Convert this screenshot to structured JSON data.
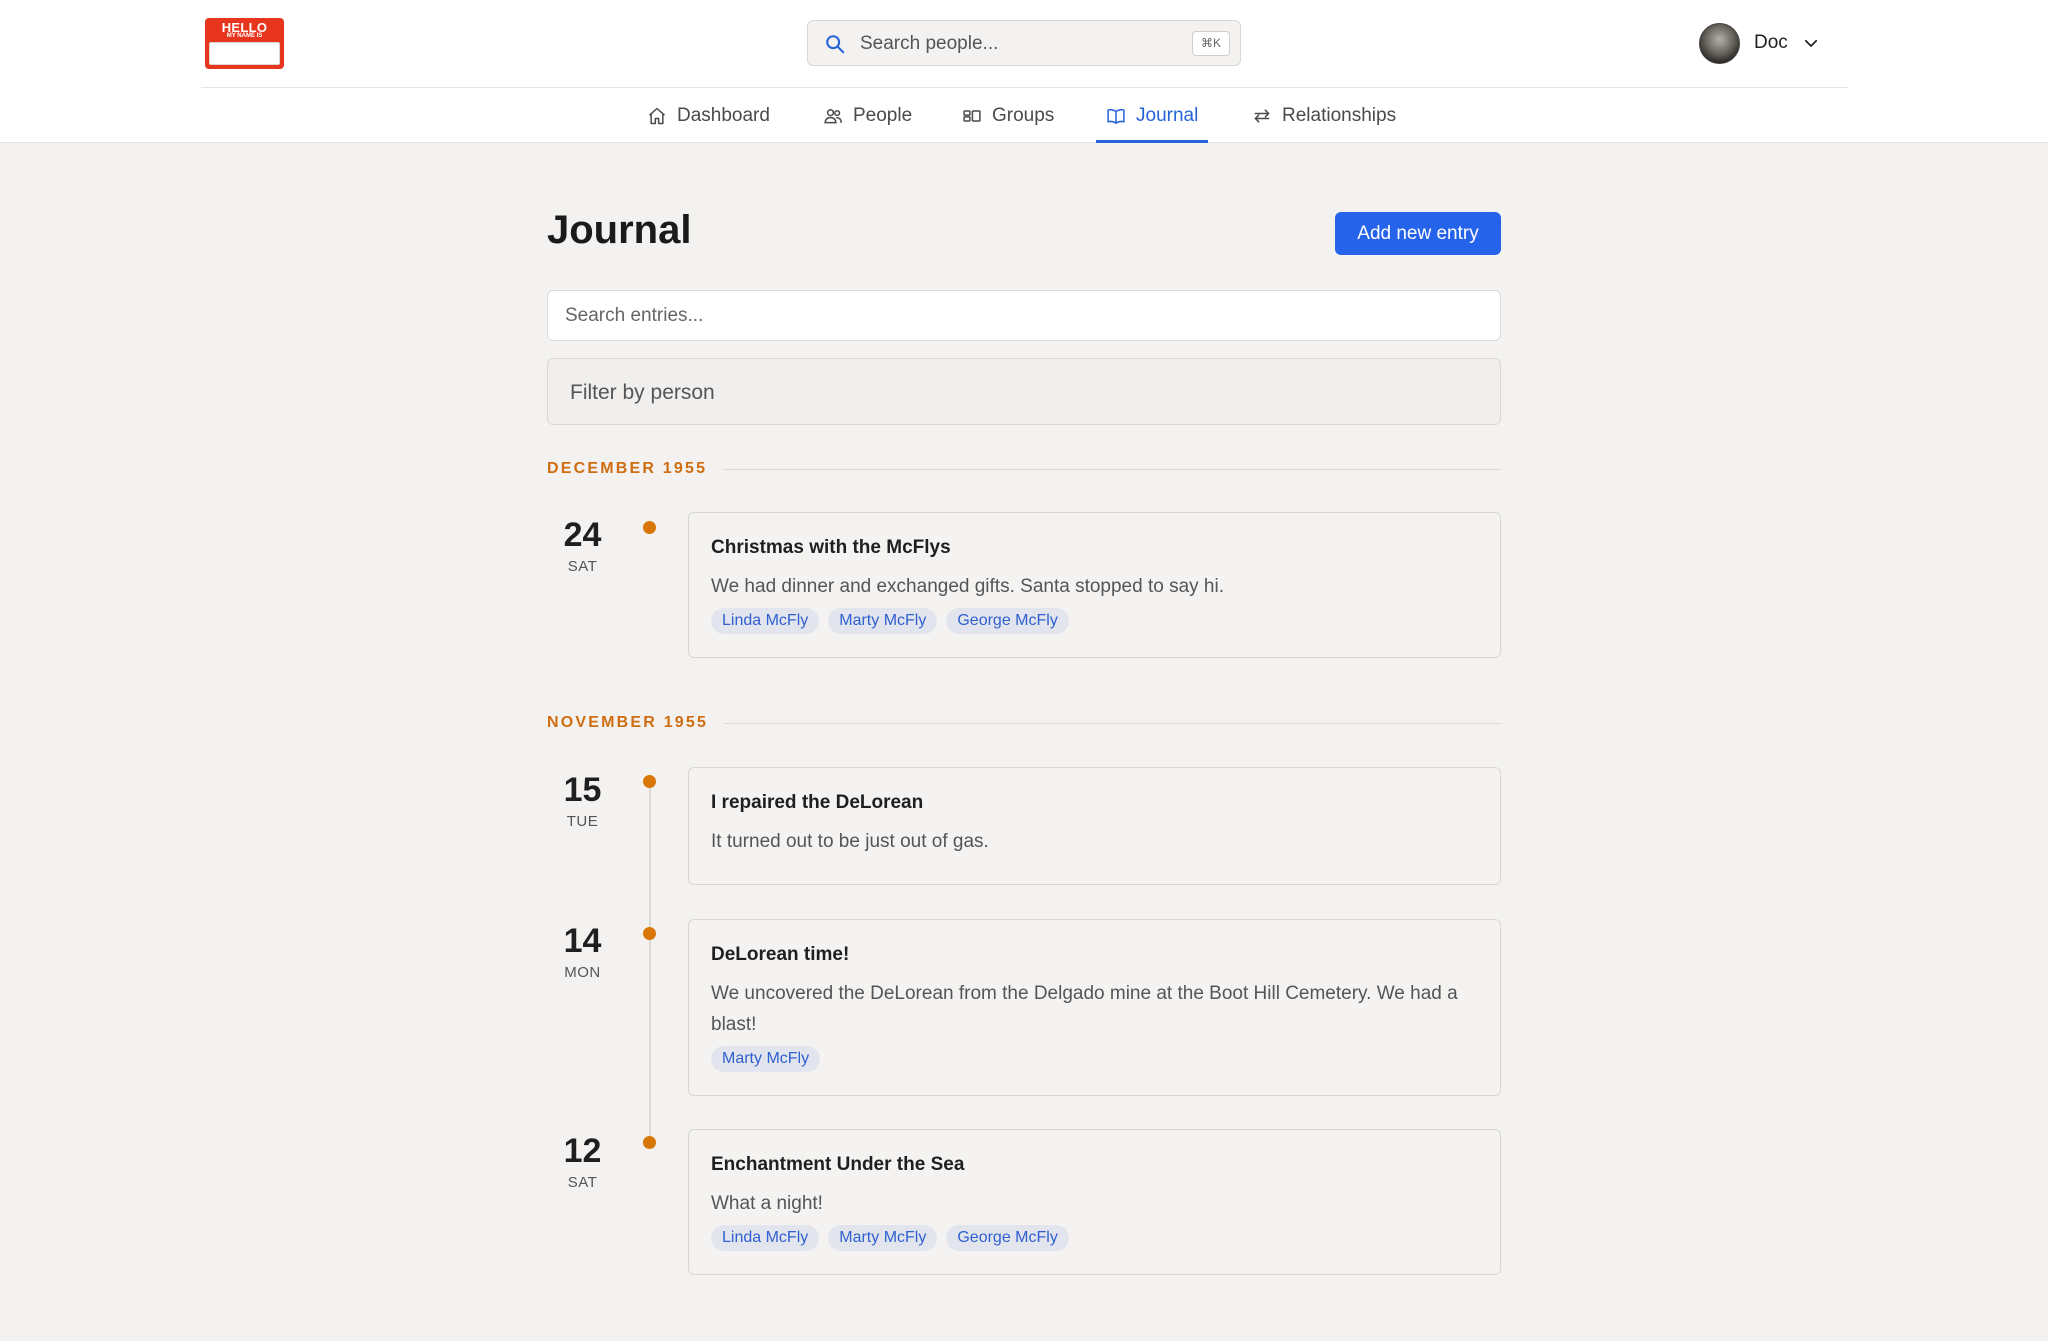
{
  "app": {
    "logo_text_line1": "HELLO",
    "logo_text_line2": "MY NAME IS"
  },
  "header": {
    "search_placeholder": "Search people...",
    "search_shortcut": "⌘K",
    "user_name": "Doc"
  },
  "nav": {
    "items": [
      {
        "label": "Dashboard",
        "icon": "home-icon"
      },
      {
        "label": "People",
        "icon": "users-icon"
      },
      {
        "label": "Groups",
        "icon": "groups-icon"
      },
      {
        "label": "Journal",
        "icon": "book-icon",
        "active": true
      },
      {
        "label": "Relationships",
        "icon": "arrows-swap-icon"
      }
    ]
  },
  "main": {
    "title": "Journal",
    "add_button": "Add new entry",
    "search_placeholder": "Search entries...",
    "filter_placeholder": "Filter by person"
  },
  "colors": {
    "accent": "#2563eb",
    "month_label": "#cf6d10",
    "timeline_dot": "#d97706",
    "tag_bg": "#e2e5ee",
    "tag_text": "#2f5fd0"
  },
  "months": [
    {
      "label": "DECEMBER 1955",
      "entries": [
        {
          "day": "24",
          "weekday": "SAT",
          "title": "Christmas with the McFlys",
          "body": "We had dinner and exchanged gifts. Santa stopped to say hi.",
          "tags": [
            "Linda McFly",
            "Marty McFly",
            "George McFly"
          ]
        }
      ]
    },
    {
      "label": "NOVEMBER 1955",
      "entries": [
        {
          "day": "15",
          "weekday": "TUE",
          "title": "I repaired the DeLorean",
          "body": "It turned out to be just out of gas.",
          "tags": []
        },
        {
          "day": "14",
          "weekday": "MON",
          "title": "DeLorean time!",
          "body": "We uncovered the DeLorean from the Delgado mine at the Boot Hill Cemetery. We had a blast!",
          "tags": [
            "Marty McFly"
          ]
        },
        {
          "day": "12",
          "weekday": "SAT",
          "title": "Enchantment Under the Sea",
          "body": "What a night!",
          "tags": [
            "Linda McFly",
            "Marty McFly",
            "George McFly"
          ]
        }
      ]
    }
  ]
}
